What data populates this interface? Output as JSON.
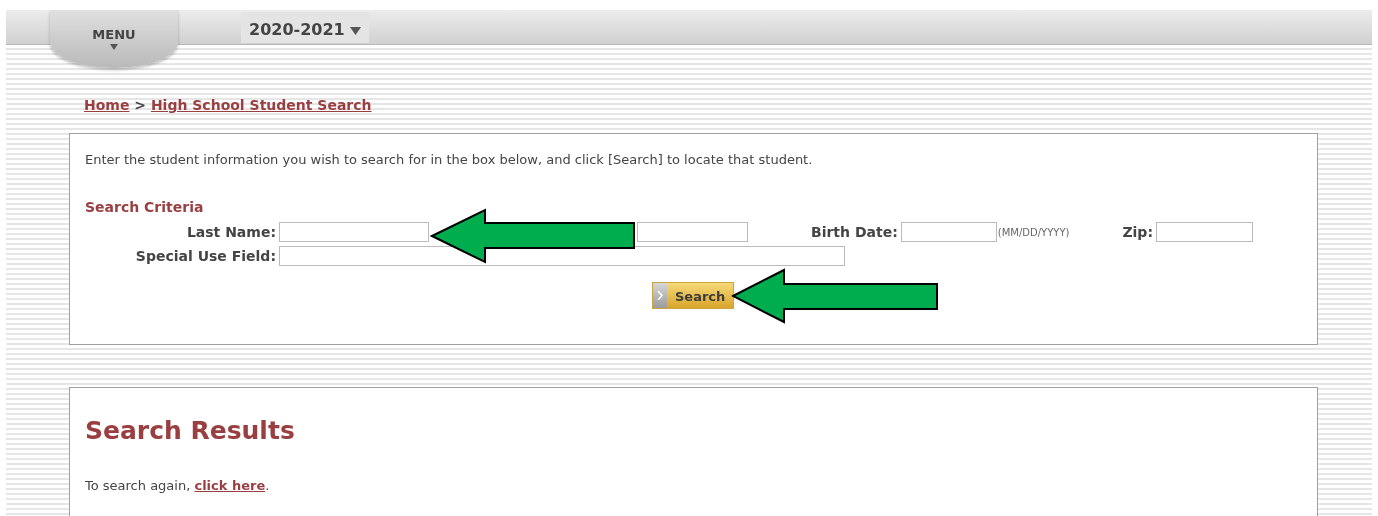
{
  "header": {
    "menu": "MENU",
    "year": "2020-2021"
  },
  "breadcrumb": {
    "items": [
      {
        "label": "Home"
      },
      {
        "label": "High School Student Search"
      }
    ],
    "separator": ">"
  },
  "search_panel": {
    "instructions": "Enter the student information you wish to search for in the box below, and click [Search] to locate that student.",
    "title": "Search Criteria",
    "rows": [
      [
        {
          "label": "Last Name:"
        },
        {},
        {
          "label": "Birth Date:",
          "hint": "(MM/DD/YYYY)"
        },
        {
          "label": "Zip:"
        }
      ],
      [
        {
          "label": "Special Use Field:"
        }
      ]
    ],
    "button": "Search"
  },
  "results": {
    "title": "Search Results",
    "text": "To search again, ",
    "link": "click here",
    "text_end": "."
  }
}
